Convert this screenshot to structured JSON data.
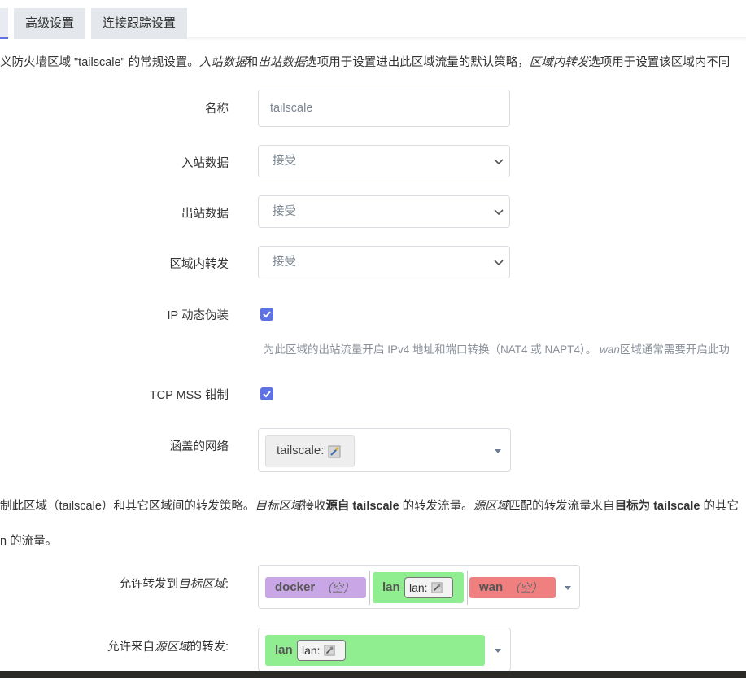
{
  "tabs": [
    {
      "label": "高级设置"
    },
    {
      "label": "连接跟踪设置"
    }
  ],
  "general": {
    "desc_p1": "义防火墙区域 \"tailscale\" 的常规设置。",
    "desc_i1": "入站数据",
    "desc_p2": "和",
    "desc_i2": "出站数据",
    "desc_p3": "选项用于设置进出此区域流量的默认策略，",
    "desc_i3": "区域内转发",
    "desc_p4": "选项用于设置该区域内不同"
  },
  "form": {
    "name_label": "名称",
    "name_value": "tailscale",
    "input_label": "入站数据",
    "input_value": "接受",
    "output_label": "出站数据",
    "output_value": "接受",
    "forward_label": "区域内转发",
    "forward_value": "接受",
    "masq_label": "IP 动态伪装",
    "masq_checked": true,
    "masq_hint_p1": "为此区域的出站流量开启 IPv4 地址和端口转换（NAT4 或 NAPT4）。",
    "masq_hint_i": "wan",
    "masq_hint_p2": "区域通常需要开启此功",
    "mss_label": "TCP MSS 钳制",
    "mss_checked": true,
    "covered_label": "涵盖的网络",
    "covered_chip": "tailscale:"
  },
  "forwarding": {
    "desc_p1": "制此区域（tailscale）和其它区域间的转发策略。",
    "desc_i1": "目标区域",
    "desc_p2": "接收",
    "desc_b1": "源自 tailscale",
    "desc_p3": " 的转发流量。",
    "desc_i2": "源区域",
    "desc_p4": "匹配的转发流量来自",
    "desc_b2": "目标为 tailscale",
    "desc_p5": " 的其它",
    "desc2": "n 的流量。",
    "dest_label_p1": "允许转发到",
    "dest_label_i": "目标区域",
    "dest_label_p2": ":",
    "dest_zones": [
      {
        "name": "docker",
        "note": "（空）",
        "color": "#c9a6e5"
      },
      {
        "name": "lan",
        "net": "lan:",
        "color": "#90ee90"
      },
      {
        "name": "wan",
        "note": "（空）",
        "color": "#f08080"
      }
    ],
    "src_label_p1": "允许来自",
    "src_label_i": "源区域",
    "src_label_p2": "的转发:",
    "src_zone": {
      "name": "lan",
      "net": "lan:",
      "color": "#90ee90"
    }
  },
  "icons": {
    "select_chevron": "chevron-down-icon",
    "dropdown_caret": "caret-down-icon",
    "network_icon": "network-interface-icon",
    "checkbox": "check-icon"
  },
  "colors": {
    "accent": "#5e72e4",
    "tab_bg": "#e4e7eb",
    "zone_docker": "#c9a6e5",
    "zone_lan": "#90ee90",
    "zone_wan": "#f08080"
  }
}
